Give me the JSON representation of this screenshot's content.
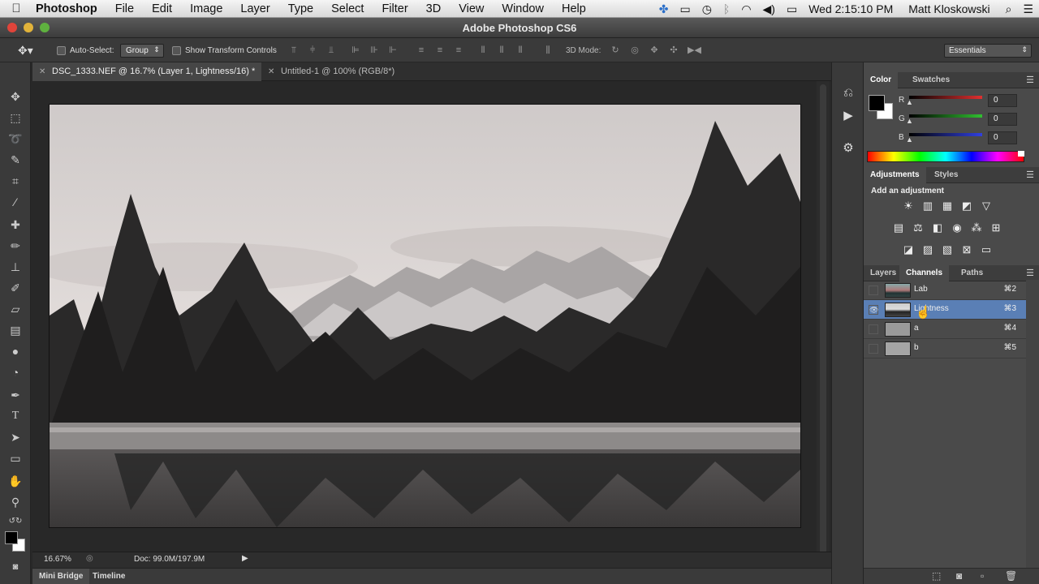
{
  "menubar": {
    "app_name": "Photoshop",
    "items": [
      "File",
      "Edit",
      "Image",
      "Layer",
      "Type",
      "Select",
      "Filter",
      "3D",
      "View",
      "Window",
      "Help"
    ],
    "clock": "Wed 2:15:10 PM",
    "user": "Matt Kloskowski"
  },
  "window": {
    "title": "Adobe Photoshop CS6"
  },
  "options": {
    "auto_select_label": "Auto-Select:",
    "auto_select_value": "Group",
    "transform_label": "Show Transform Controls",
    "mode_3d_label": "3D Mode:",
    "workspace": "Essentials"
  },
  "tabs": [
    {
      "label": "DSC_1333.NEF @ 16.7% (Layer 1, Lightness/16) *"
    },
    {
      "label": "Untitled-1 @ 100% (RGB/8*)"
    }
  ],
  "status": {
    "zoom": "16.67%",
    "doc": "Doc: 99.0M/197.9M"
  },
  "bottom_tabs": [
    "Mini Bridge",
    "Timeline"
  ],
  "color_panel": {
    "tabs": [
      "Color",
      "Swatches"
    ],
    "channels": [
      {
        "label": "R",
        "value": "0",
        "color": "#e03030"
      },
      {
        "label": "G",
        "value": "0",
        "color": "#30c030"
      },
      {
        "label": "B",
        "value": "0",
        "color": "#3040e0"
      }
    ]
  },
  "adjustments_panel": {
    "tabs": [
      "Adjustments",
      "Styles"
    ],
    "heading": "Add an adjustment"
  },
  "channels_panel": {
    "tabs": [
      "Layers",
      "Channels",
      "Paths"
    ],
    "channels": [
      {
        "name": "Lab",
        "shortcut": "⌘2",
        "visible": false
      },
      {
        "name": "Lightness",
        "shortcut": "⌘3",
        "visible": true
      },
      {
        "name": "a",
        "shortcut": "⌘4",
        "visible": false
      },
      {
        "name": "b",
        "shortcut": "⌘5",
        "visible": false
      }
    ]
  }
}
